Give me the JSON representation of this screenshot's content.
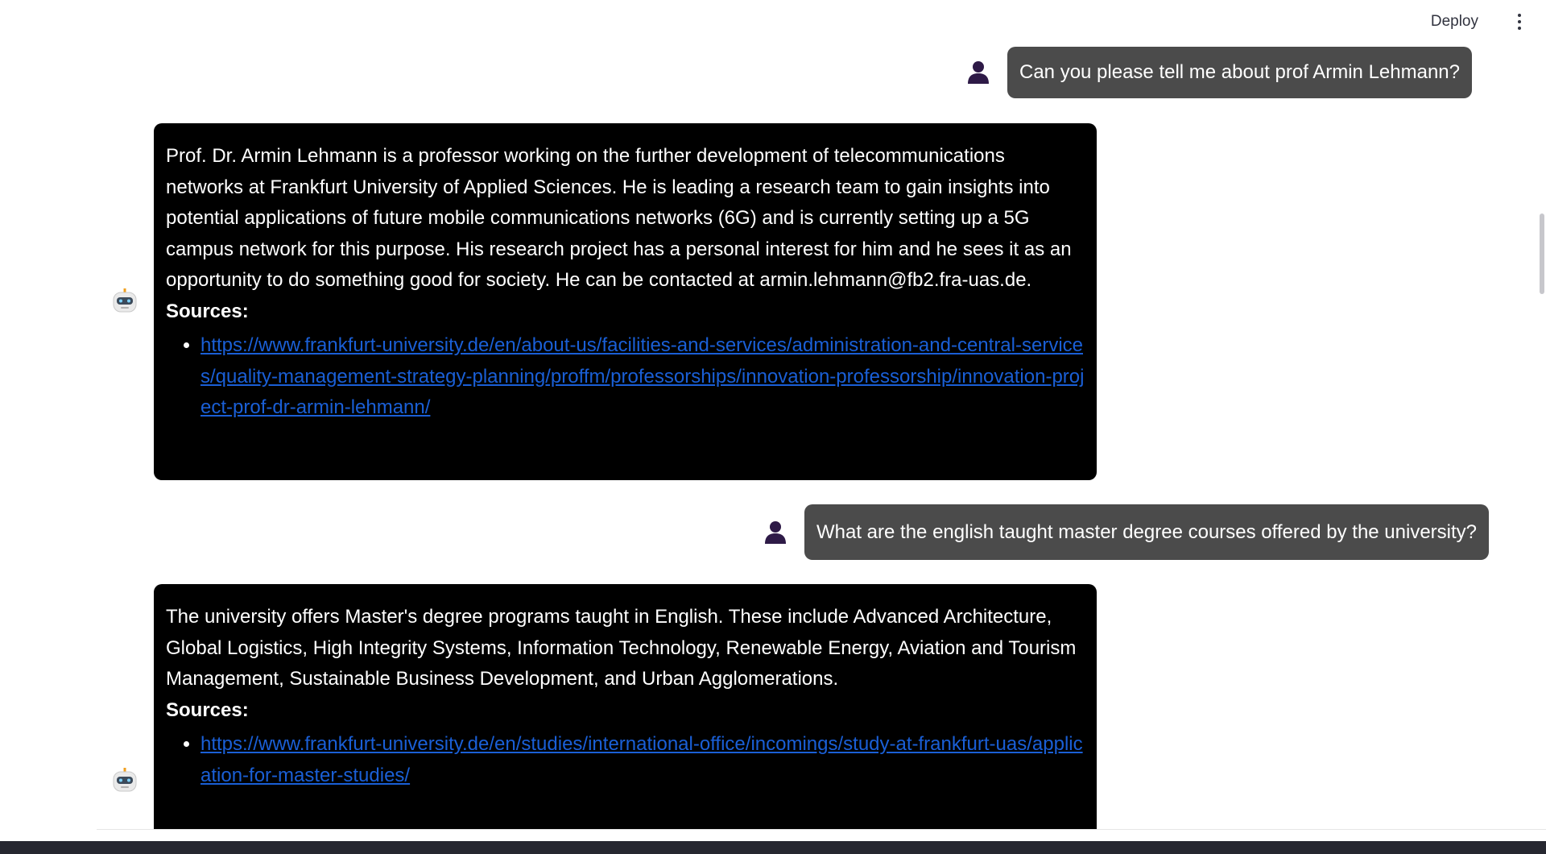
{
  "header": {
    "deploy_label": "Deploy",
    "menu_icon": "vertical-dots-icon"
  },
  "conversation": [
    {
      "role": "user",
      "avatar_icon": "user-silhouette-icon",
      "text": "Can you please tell me about prof Armin Lehmann?"
    },
    {
      "role": "assistant",
      "avatar_icon": "robot-icon",
      "text": "Prof. Dr. Armin Lehmann is a professor working on the further development of telecommunications networks at Frankfurt University of Applied Sciences. He is leading a research team to gain insights into potential applications of future mobile communications networks (6G) and is currently setting up a 5G campus network for this purpose. His research project has a personal interest for him and he sees it as an opportunity to do something good for society. He can be contacted at armin.lehmann@fb2.fra-uas.de.",
      "sources_title": "Sources:",
      "sources": [
        "https://www.frankfurt-university.de/en/about-us/facilities-and-services/administration-and-central-services/quality-management-strategy-planning/proffm/professorships/innovation-professorship/innovation-project-prof-dr-armin-lehmann/"
      ]
    },
    {
      "role": "user",
      "avatar_icon": "user-silhouette-icon",
      "text": "What are the english taught master degree courses offered by the university?"
    },
    {
      "role": "assistant",
      "avatar_icon": "robot-icon",
      "text": "The university offers Master's degree programs taught in English. These include Advanced Architecture, Global Logistics, High Integrity Systems, Information Technology, Renewable Energy, Aviation and Tourism Management, Sustainable Business Development, and Urban Agglomerations.",
      "sources_title": "Sources:",
      "sources": [
        "https://www.frankfurt-university.de/en/studies/international-office/incomings/study-at-frankfurt-uas/application-for-master-studies/"
      ]
    }
  ],
  "colors": {
    "user_bubble": "#4b4b4b",
    "bot_bubble": "#000000",
    "link": "#1a5fd6",
    "bottom_bar": "#262730"
  }
}
